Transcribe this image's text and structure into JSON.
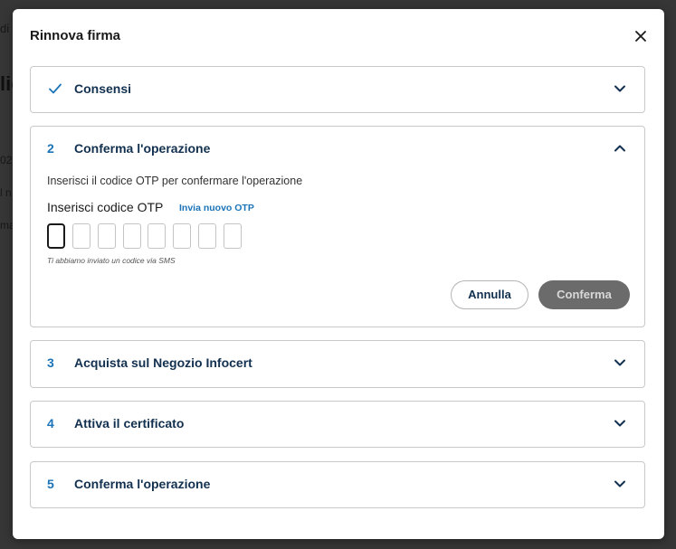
{
  "background": {
    "fragments": [
      "di",
      "lic",
      "02",
      "l n",
      "ma"
    ]
  },
  "modal": {
    "title": "Rinnova firma",
    "close_icon": "close-icon"
  },
  "steps": [
    {
      "marker": "check",
      "title": "Consensi",
      "expanded": false
    },
    {
      "number": "2",
      "title": "Conferma l'operazione",
      "expanded": true,
      "description": "Inserisci il codice OTP per confermare l'operazione",
      "otp_label": "Inserisci codice OTP",
      "resend_link": "Invia nuovo OTP",
      "otp_length": 8,
      "otp_values": [
        "",
        "",
        "",
        "",
        "",
        "",
        "",
        ""
      ],
      "hint": "Ti abbiamo inviato un codice via SMS",
      "cancel_label": "Annulla",
      "confirm_label": "Conferma"
    },
    {
      "number": "3",
      "title": "Acquista sul Negozio Infocert",
      "expanded": false
    },
    {
      "number": "4",
      "title": "Attiva il certificato",
      "expanded": false
    },
    {
      "number": "5",
      "title": "Conferma l'operazione",
      "expanded": false
    }
  ],
  "colors": {
    "accent": "#1b74b8",
    "heading": "#12304f",
    "disabled_button": "#6b6b6b"
  }
}
